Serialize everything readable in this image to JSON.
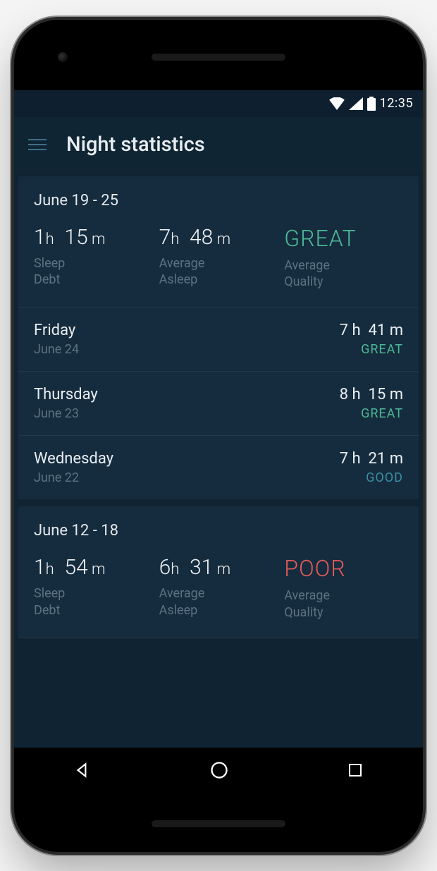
{
  "status": {
    "time": "12:35"
  },
  "header": {
    "title": "Night statistics"
  },
  "labels": {
    "sleep_debt": "Sleep\nDebt",
    "average_asleep": "Average\nAsleep",
    "average_quality": "Average\nQuality"
  },
  "colors": {
    "quality": {
      "GREAT": "#4db896",
      "GOOD": "#3a8fa3",
      "POOR": "#e05a5a"
    }
  },
  "weeks": [
    {
      "range": "June 19 - 25",
      "sleep_debt": {
        "h": 1,
        "m": 15
      },
      "average_asleep": {
        "h": 7,
        "m": 48
      },
      "average_quality": "GREAT",
      "days": [
        {
          "name": "Friday",
          "date": "June 24",
          "duration": {
            "h": 7,
            "m": 41
          },
          "quality": "GREAT"
        },
        {
          "name": "Thursday",
          "date": "June 23",
          "duration": {
            "h": 8,
            "m": 15
          },
          "quality": "GREAT"
        },
        {
          "name": "Wednesday",
          "date": "June 22",
          "duration": {
            "h": 7,
            "m": 21
          },
          "quality": "GOOD"
        }
      ]
    },
    {
      "range": "June 12 - 18",
      "sleep_debt": {
        "h": 1,
        "m": 54
      },
      "average_asleep": {
        "h": 6,
        "m": 31
      },
      "average_quality": "POOR",
      "days": []
    }
  ]
}
